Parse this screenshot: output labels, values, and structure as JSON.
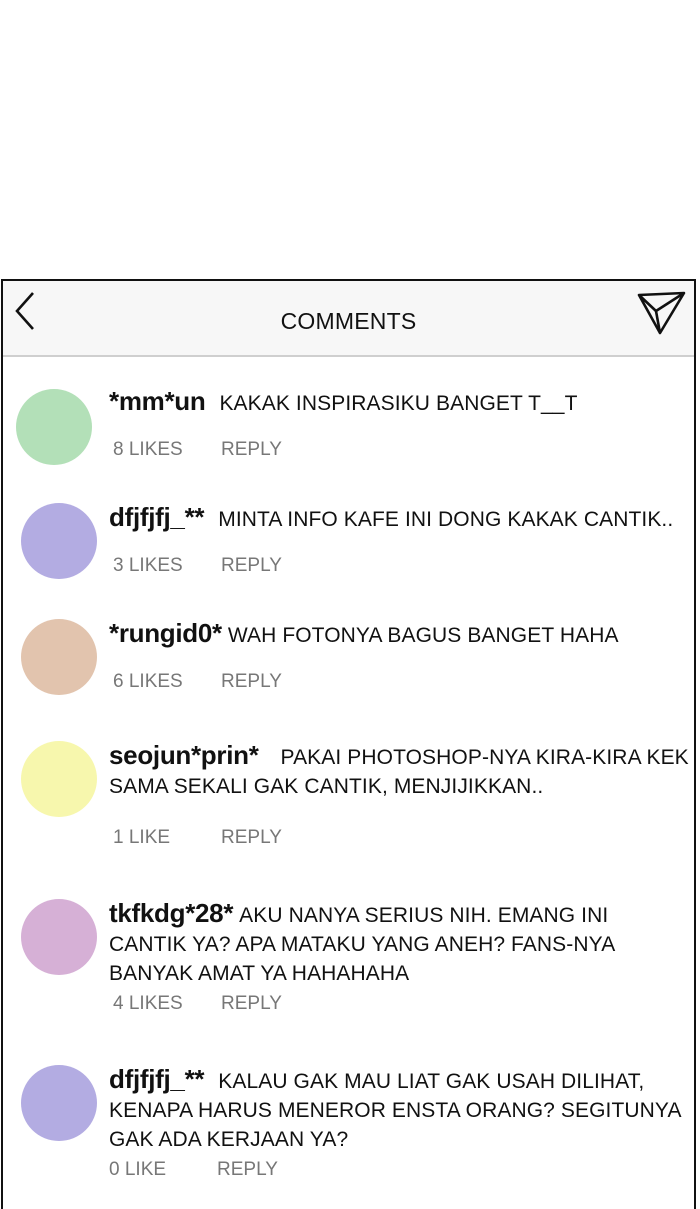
{
  "header": {
    "title": "COMMENTS"
  },
  "comments": [
    {
      "user": "*mm*un",
      "text": "KAKAK INSPIRASIKU BANGET T__T",
      "likes": "8 LIKES",
      "reply": "REPLY",
      "avatar_color": "#b3e0b8"
    },
    {
      "user": "dfjfjfj_**",
      "text": "MINTA INFO KAFE INI DONG KAKAK CANTIK..",
      "likes": "3 LIKES",
      "reply": "REPLY",
      "avatar_color": "#b3ace2"
    },
    {
      "user": "*rungid0*",
      "text": "WAH FOTONYA BAGUS BANGET HAHA",
      "likes": "6 LIKES",
      "reply": "REPLY",
      "avatar_color": "#e2c4ae"
    },
    {
      "user": "seojun*prin*",
      "text": "PAKAI PHOTOSHOP-NYA KIRA-KIRA KEK SAMA SEKALI GAK CANTIK, MENJIJIKKAN..",
      "likes": "1 LIKE",
      "reply": "REPLY",
      "avatar_color": "#f7f7ad"
    },
    {
      "user": "tkfkdg*28*",
      "text": "AKU NANYA SERIUS NIH. EMANG INI CANTIK YA? APA MATAKU YANG ANEH? FANS-NYA BANYAK AMAT YA HAHAHAHA",
      "likes": "4 LIKES",
      "reply": "REPLY",
      "avatar_color": "#d6b0d6"
    },
    {
      "user": "dfjfjfj_**",
      "text": "KALAU GAK MAU LIAT GAK USAH DILIHAT, KENAPA HARUS MENEROR ENSTA ORANG? SEGITUNYA GAK ADA KERJAAN YA?",
      "likes": "0 LIKE",
      "reply": "REPLY",
      "avatar_color": "#b3ace2"
    }
  ]
}
